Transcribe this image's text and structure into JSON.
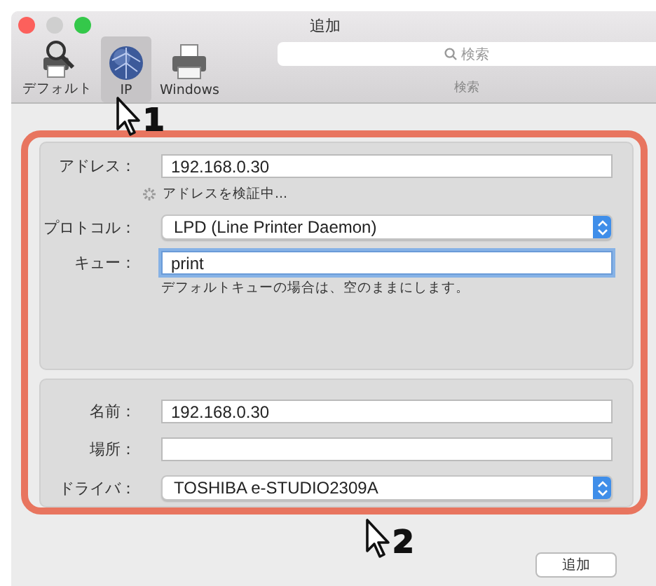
{
  "window": {
    "title": "追加"
  },
  "toolbar": {
    "items": [
      {
        "label": "デフォルト",
        "kind": "default",
        "selected": false
      },
      {
        "label": "IP",
        "kind": "ip",
        "selected": true
      },
      {
        "label": "Windows",
        "kind": "windows",
        "selected": false
      }
    ],
    "search": {
      "placeholder": "検索",
      "label": "検索"
    }
  },
  "connection": {
    "fields": [
      {
        "kind": "text",
        "label": "アドレス：",
        "value": "192.168.0.30",
        "focused": false
      },
      {
        "kind": "status",
        "text": "アドレスを検証中..."
      },
      {
        "kind": "popup",
        "label": "プロトコル：",
        "value": "LPD (Line Printer Daemon)"
      },
      {
        "kind": "text",
        "label": "キュー：",
        "value": "print",
        "focused": true
      },
      {
        "kind": "hint",
        "text": "デフォルトキューの場合は、空のままにします。"
      }
    ]
  },
  "details": {
    "fields": [
      {
        "kind": "text",
        "label": "名前：",
        "value": "192.168.0.30",
        "focused": false
      },
      {
        "kind": "text",
        "label": "場所：",
        "focused": false
      },
      {
        "kind": "popup",
        "label": "ドライバ：",
        "value": "TOSHIBA e-STUDIO2309A"
      }
    ]
  },
  "buttons": [
    {
      "label": "追加"
    }
  ],
  "annotations": [
    {
      "number": "1"
    },
    {
      "number": "2"
    }
  ]
}
